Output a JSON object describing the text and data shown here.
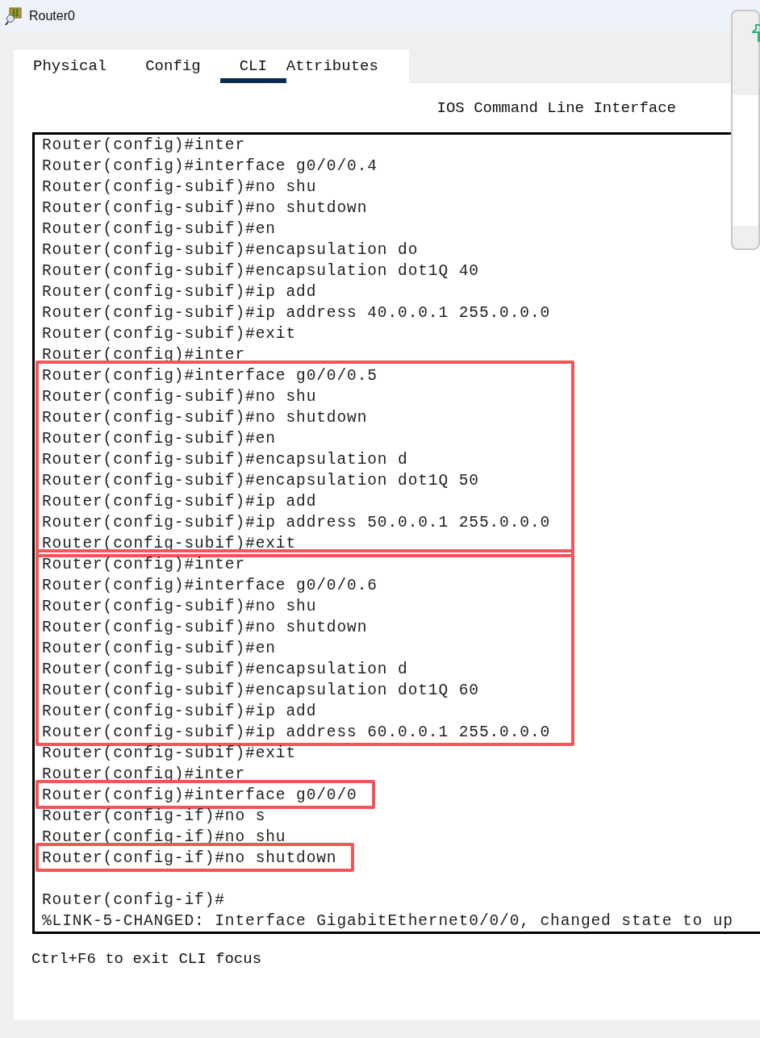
{
  "window": {
    "title": "Router0"
  },
  "tabs": [
    {
      "label": "Physical",
      "selected": false
    },
    {
      "label": "Config",
      "selected": false
    },
    {
      "label": "CLI",
      "selected": true
    },
    {
      "label": "Attributes",
      "selected": false
    }
  ],
  "heading": "IOS Command Line Interface",
  "terminal": {
    "blocks": [
      {
        "highlighted": false,
        "lines": [
          {
            "text": "Router(config)#inter"
          },
          {
            "text": "Router(config)#interface g0/0/0.4"
          },
          {
            "text": "Router(config-subif)#no shu"
          },
          {
            "text": "Router(config-subif)#no shutdown"
          },
          {
            "text": "Router(config-subif)#en"
          },
          {
            "text": "Router(config-subif)#encapsulation do"
          },
          {
            "text": "Router(config-subif)#encapsulation dot1Q 40"
          },
          {
            "text": "Router(config-subif)#ip add"
          },
          {
            "text": "Router(config-subif)#ip address 40.0.0.1 255.0.0.0"
          },
          {
            "text": "Router(config-subif)#exit"
          },
          {
            "text": "Router(config)#inter"
          }
        ]
      },
      {
        "highlighted": true,
        "lines": [
          {
            "text": "Router(config)#interface g0/0/0.5"
          },
          {
            "text": "Router(config-subif)#no shu"
          },
          {
            "text": "Router(config-subif)#no shutdown"
          },
          {
            "text": "Router(config-subif)#en"
          },
          {
            "text": "Router(config-subif)#encapsulation d"
          },
          {
            "text": "Router(config-subif)#encapsulation dot1Q 50"
          },
          {
            "text": "Router(config-subif)#ip add"
          },
          {
            "text": "Router(config-subif)#ip address 50.0.0.1 255.0.0.0"
          },
          {
            "text": "Router(config-subif)#exit"
          }
        ]
      },
      {
        "highlighted": true,
        "lines": [
          {
            "text": "Router(config)#inter"
          },
          {
            "text": "Router(config)#interface g0/0/0.6"
          },
          {
            "text": "Router(config-subif)#no shu"
          },
          {
            "text": "Router(config-subif)#no shutdown"
          },
          {
            "text": "Router(config-subif)#en"
          },
          {
            "text": "Router(config-subif)#encapsulation d"
          },
          {
            "text": "Router(config-subif)#encapsulation dot1Q 60"
          },
          {
            "text": "Router(config-subif)#ip add"
          },
          {
            "text": "Router(config-subif)#ip address 60.0.0.1 255.0.0.0"
          }
        ]
      },
      {
        "highlighted": false,
        "lines": [
          {
            "text": "Router(config-subif)#exit"
          },
          {
            "text": "Router(config)#inter"
          }
        ]
      },
      {
        "highlighted": true,
        "lines": [
          {
            "text": "Router(config)#interface g0/0/0"
          }
        ]
      },
      {
        "highlighted": false,
        "lines": [
          {
            "text": "Router(config-if)#no s"
          },
          {
            "text": "Router(config-if)#no shu"
          }
        ]
      },
      {
        "highlighted": true,
        "lines": [
          {
            "text": "Router(config-if)#no shutdown"
          }
        ]
      },
      {
        "highlighted": false,
        "lines": [
          {
            "text": "Router(config-if)#",
            "gap_before": true
          },
          {
            "text": "%LINK-5-CHANGED: Interface GigabitEthernet0/0/0, changed state to up"
          }
        ]
      }
    ]
  },
  "hint": "Ctrl+F6 to exit CLI focus"
}
